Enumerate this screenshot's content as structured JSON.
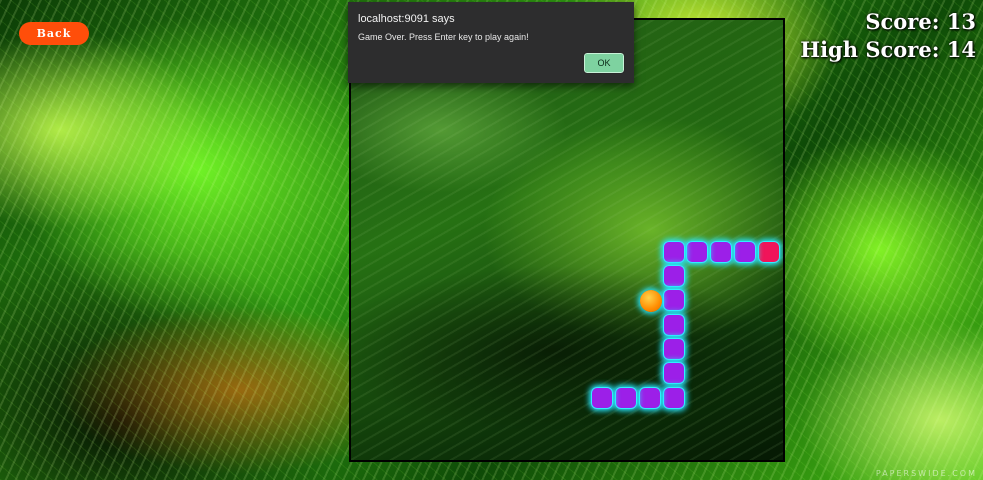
{
  "page": {
    "back_label": "Back",
    "score_text": "Score: 13",
    "high_score_text": "High Score: 14",
    "watermark": "PAPERSWIDE.COM"
  },
  "alert": {
    "origin": "localhost:9091 says",
    "message": "Game Over. Press Enter key to play again!",
    "ok_label": "OK"
  },
  "game": {
    "score": 13,
    "high_score": 14,
    "status": "game-over",
    "colors": {
      "snake_body": "#9c1fe8",
      "snake_head": "#f0145a",
      "snake_glow": "#27e6ff",
      "food": "#ff8c00",
      "back_button": "#ff4e0a"
    }
  }
}
